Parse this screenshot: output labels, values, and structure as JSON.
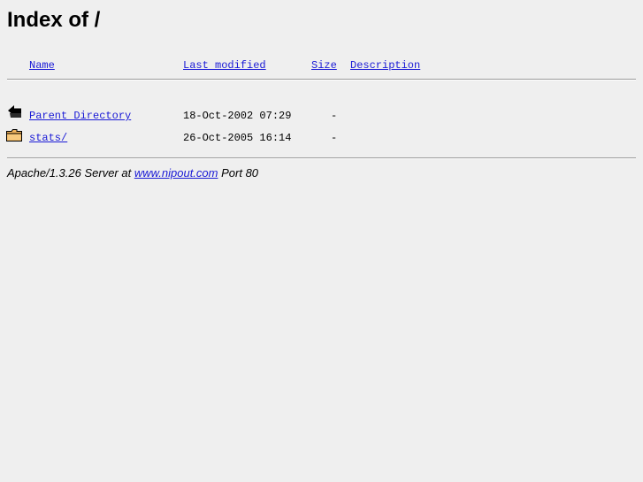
{
  "page": {
    "title": "Index of /"
  },
  "listing": {
    "headers": {
      "name": "Name",
      "last_modified": "Last modified",
      "size": "Size",
      "description": "Description"
    },
    "rows": [
      {
        "icon": "back-arrow-icon",
        "name": "Parent Directory",
        "modified": "18-Oct-2002 07:29",
        "size": "-",
        "description": ""
      },
      {
        "icon": "folder-icon",
        "name": "stats/",
        "modified": "26-Oct-2005 16:14",
        "size": "-",
        "description": ""
      }
    ]
  },
  "footer": {
    "server": "Apache/1.3.26 Server at",
    "host": "www.nipout.com",
    "port": "Port 80"
  },
  "colors": {
    "background": "#efefef",
    "link": "#1a1ad6",
    "rule": "#9a9a9a"
  }
}
